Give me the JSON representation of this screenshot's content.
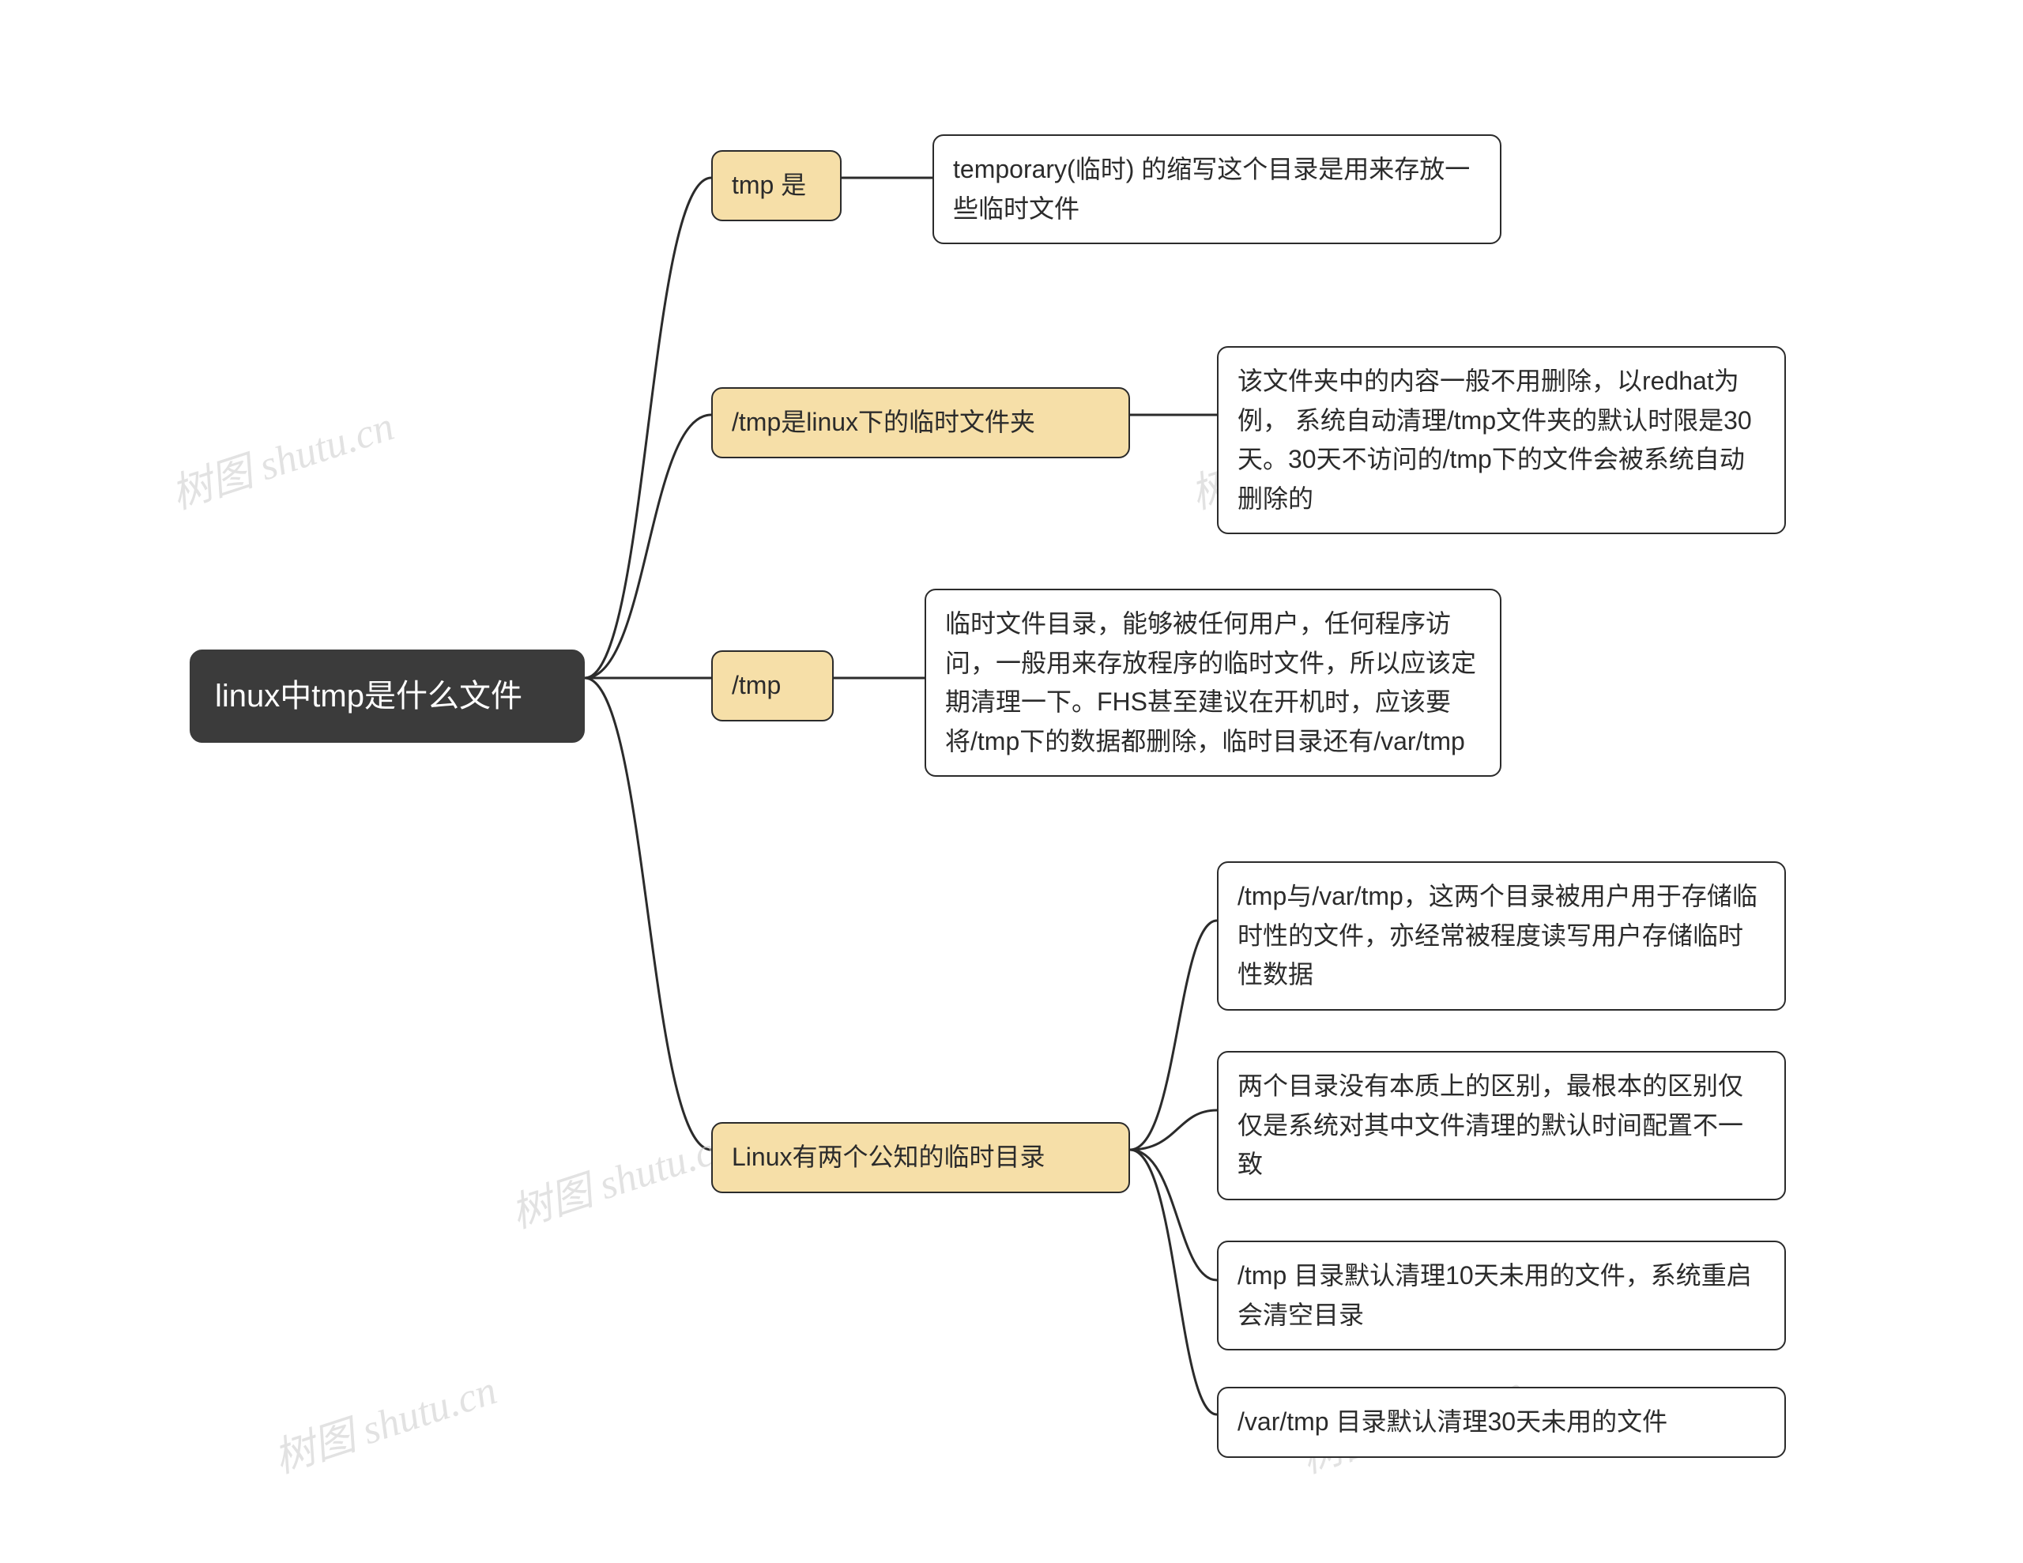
{
  "root": {
    "title": "linux中tmp是什么文件"
  },
  "branches": [
    {
      "label": "tmp 是",
      "leaves": [
        "temporary(临时) 的缩写这个目录是用来存放一些临时文件"
      ]
    },
    {
      "label": "/tmp是linux下的临时文件夹",
      "leaves": [
        "该文件夹中的内容一般不用删除，以redhat为例， 系统自动清理/tmp文件夹的默认时限是30天。30天不访问的/tmp下的文件会被系统自动删除的"
      ]
    },
    {
      "label": "/tmp",
      "leaves": [
        "临时文件目录，能够被任何用户，任何程序访问，一般用来存放程序的临时文件，所以应该定期清理一下。FHS甚至建议在开机时，应该要将/tmp下的数据都删除，临时目录还有/var/tmp"
      ]
    },
    {
      "label": "Linux有两个公知的临时目录",
      "leaves": [
        "/tmp与/var/tmp，这两个目录被用户用于存储临时性的文件，亦经常被程度读写用户存储临时性数据",
        "两个目录没有本质上的区别，最根本的区别仅仅是系统对其中文件清理的默认时间配置不一致",
        "/tmp 目录默认清理10天未用的文件，系统重启会清空目录",
        "/var/tmp 目录默认清理30天未用的文件"
      ]
    }
  ],
  "watermark": "树图 shutu.cn"
}
